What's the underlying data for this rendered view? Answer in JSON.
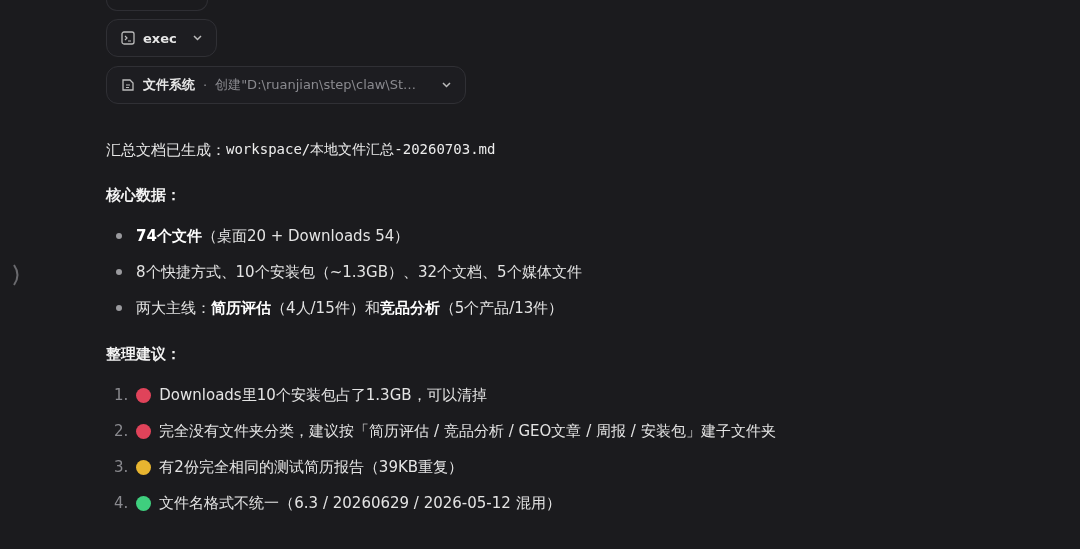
{
  "tool_calls": [
    {
      "kind": "terminal",
      "label": "exec",
      "expanded": false
    },
    {
      "kind": "file",
      "label": "文件系统",
      "separator": "·",
      "detail": "创建\"D:\\ruanjian\\step\\claw\\St…",
      "expanded": false
    }
  ],
  "summary": {
    "label": "汇总文档已生成：",
    "path": "workspace/本地文件汇总-20260703.md"
  },
  "sections": [
    {
      "heading": "核心数据：",
      "kind": "bullets",
      "items": [
        {
          "text": "**74个文件**（桌面20 + Downloads 54）"
        },
        {
          "text": "8个快捷方式、10个安装包（~1.3GB）、32个文档、5个媒体文件"
        },
        {
          "text": "两大主线：**简历评估**（4人/15件）和**竞品分析**（5个产品/13件）"
        }
      ]
    },
    {
      "heading": "整理建议：",
      "kind": "numbered",
      "items": [
        {
          "number": "1.",
          "color": "#e0435a",
          "text": "Downloads里10个安装包占了1.3GB，可以清掉"
        },
        {
          "number": "2.",
          "color": "#e0435a",
          "text": "完全没有文件夹分类，建议按「简历评估 / 竞品分析 / GEO文章 / 周报 / 安装包」建子文件夹"
        },
        {
          "number": "3.",
          "color": "#e8b530",
          "text": "有2份完全相同的测试简历报告（39KB重复）"
        },
        {
          "number": "4.",
          "color": "#3fcf7e",
          "text": "文件名格式不统一（6.3 / 20260629 / 2026-05-12 混用）"
        }
      ]
    }
  ]
}
